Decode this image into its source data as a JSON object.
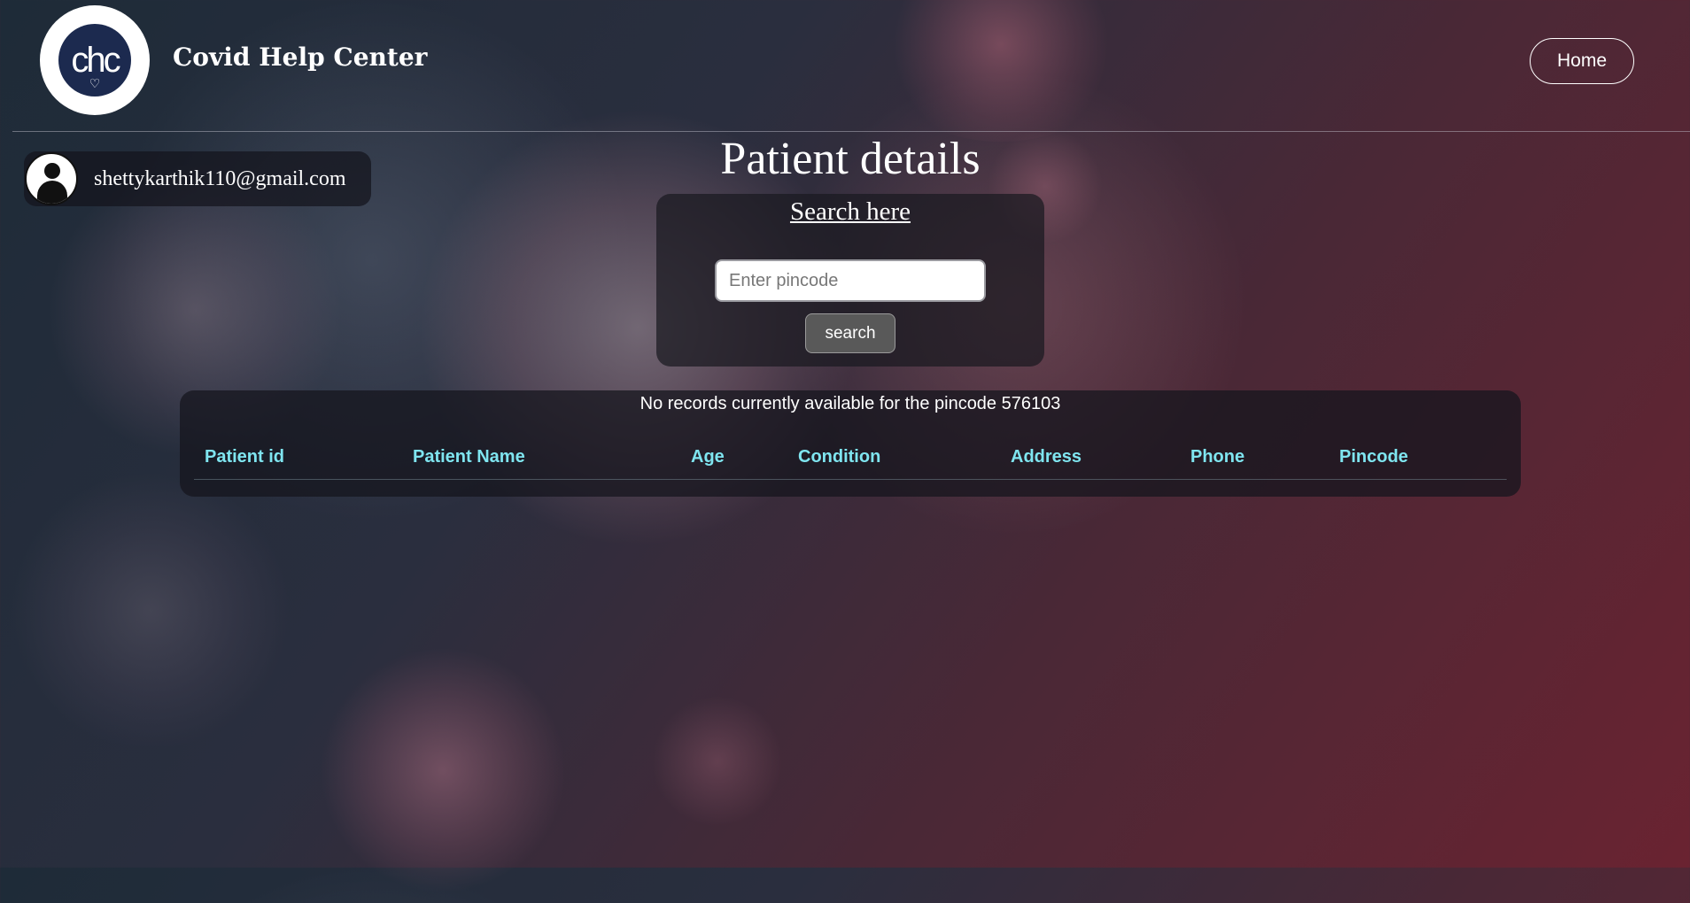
{
  "header": {
    "logo_text": "chc",
    "brand": "Covid Help Center",
    "home_label": "Home"
  },
  "user": {
    "email": "shettykarthik110@gmail.com"
  },
  "page": {
    "title": "Patient details"
  },
  "search": {
    "heading": "Search here",
    "placeholder": "Enter pincode",
    "button_label": "search"
  },
  "results": {
    "message": "No records currently available for the pincode 576103",
    "columns": [
      "Patient id",
      "Patient Name",
      "Age",
      "Condition",
      "Address",
      "Phone",
      "Pincode"
    ]
  },
  "icons": {
    "avatar": "user-avatar-icon",
    "logo": "chc-logo-heart-hand"
  }
}
